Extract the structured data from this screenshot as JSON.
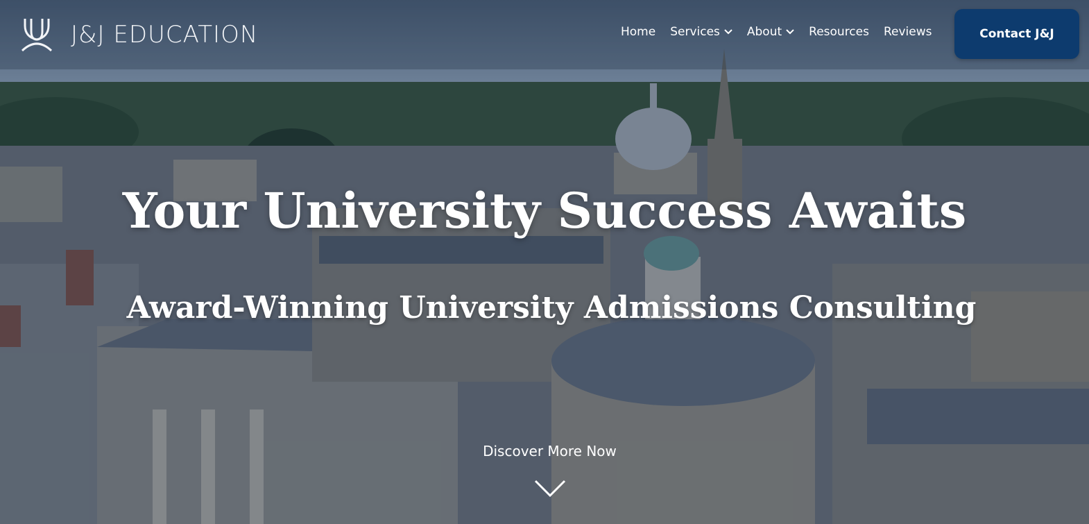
{
  "brand": {
    "name": "J&J EDUCATION"
  },
  "nav": {
    "items": [
      {
        "label": "Home"
      },
      {
        "label": "Services"
      },
      {
        "label": "About"
      },
      {
        "label": "Resources"
      },
      {
        "label": "Reviews"
      }
    ],
    "contact_label": "Contact J&J"
  },
  "hero": {
    "title": "Your University Success Awaits",
    "subtitle": "Award-Winning University Admissions Consulting",
    "cta": "Discover More Now"
  },
  "colors": {
    "contact_button": "#0d3b6e",
    "overlay": "#122642"
  }
}
